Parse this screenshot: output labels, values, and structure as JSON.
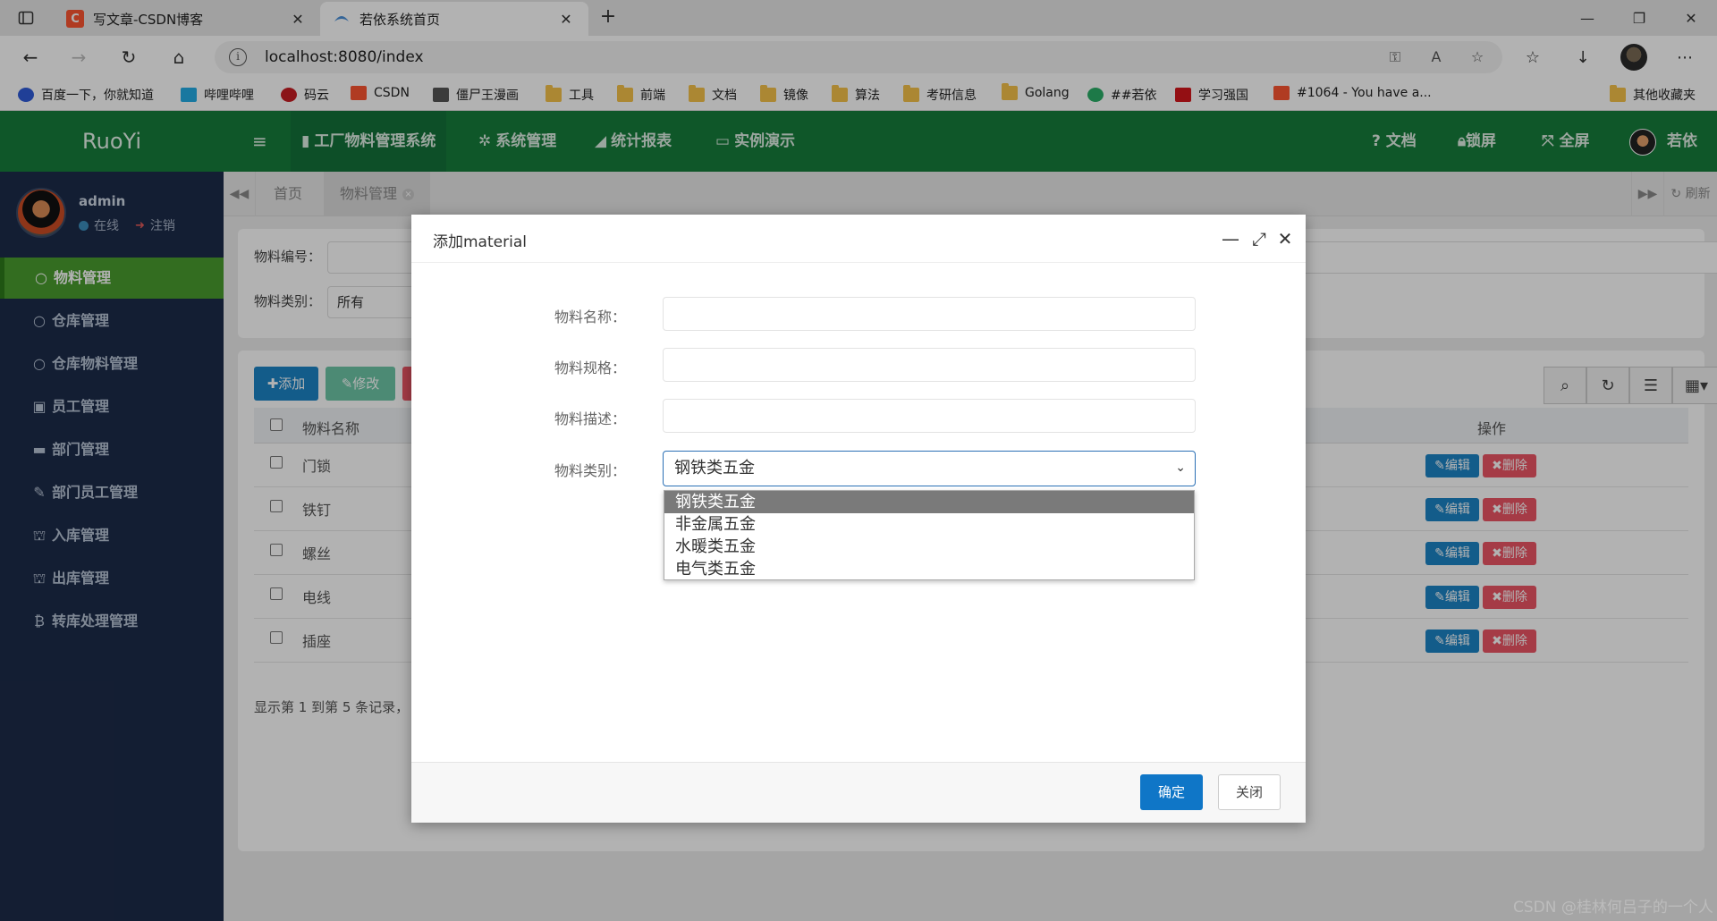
{
  "browser": {
    "tabs": [
      {
        "title": "写文章-CSDN博客",
        "favicon_letter": "C",
        "favicon_color": "#fc5531",
        "close": "✕"
      },
      {
        "title": "若依系统首页",
        "close": "✕"
      }
    ],
    "new_tab": "+",
    "window_controls": {
      "minimize": "—",
      "restore": "❐",
      "close": "✕"
    },
    "url": "localhost:8080/index",
    "bookmarks": [
      {
        "label": "百度一下，你就知道",
        "icon": "baidu-icon"
      },
      {
        "label": "哔哩哔哩",
        "icon": "bilibili-icon"
      },
      {
        "label": "码云",
        "icon": "gitee-icon"
      },
      {
        "label": "CSDN",
        "icon": "csdn-icon"
      },
      {
        "label": "僵尸王漫画",
        "icon": "manga-icon"
      },
      {
        "label": "工具",
        "icon": "folder-icon"
      },
      {
        "label": "前端",
        "icon": "folder-icon"
      },
      {
        "label": "文档",
        "icon": "folder-icon"
      },
      {
        "label": "镜像",
        "icon": "folder-icon"
      },
      {
        "label": "算法",
        "icon": "folder-icon"
      },
      {
        "label": "考研信息",
        "icon": "folder-icon"
      },
      {
        "label": "Golang",
        "icon": "folder-icon"
      },
      {
        "label": "##若依",
        "icon": "wechat-icon"
      },
      {
        "label": "学习强国",
        "icon": "xuexi-icon"
      },
      {
        "label": "#1064 - You have a...",
        "icon": "csdn-icon"
      },
      {
        "label": "其他收藏夹",
        "icon": "folder-icon"
      }
    ]
  },
  "app": {
    "brand": "RuoYi",
    "top_menu": [
      {
        "label": "工厂物料管理系统",
        "icon": "bookmark-icon"
      },
      {
        "label": "系统管理",
        "icon": "gear-icon"
      },
      {
        "label": "统计报表",
        "icon": "chart-icon"
      },
      {
        "label": "实例演示",
        "icon": "desktop-icon"
      }
    ],
    "top_right": [
      {
        "label": "文档",
        "icon": "question-icon"
      },
      {
        "label": "锁屏",
        "icon": "lock-icon"
      },
      {
        "label": "全屏",
        "icon": "fullscreen-icon"
      }
    ],
    "user_top": "若依",
    "sidebar": {
      "user_name": "admin",
      "status": "在线",
      "logout": "注销",
      "items": [
        {
          "label": "物料管理",
          "active": true
        },
        {
          "label": "仓库管理"
        },
        {
          "label": "仓库物料管理"
        },
        {
          "label": "员工管理"
        },
        {
          "label": "部门管理"
        },
        {
          "label": "部门员工管理"
        },
        {
          "label": "入库管理"
        },
        {
          "label": "出库管理"
        },
        {
          "label": "转库处理管理"
        }
      ]
    },
    "page_tabs": [
      {
        "label": "首页"
      },
      {
        "label": "物料管理",
        "active": true
      }
    ],
    "refresh": "刷新",
    "search": {
      "code_label": "物料编号：",
      "category_label": "物料类别：",
      "category_value": "所有"
    },
    "toolbar": {
      "add": "添加",
      "edit": "修改"
    },
    "table": {
      "headers": {
        "name": "物料名称",
        "actions": "操作"
      },
      "rows": [
        {
          "name": "门锁"
        },
        {
          "name": "铁钉"
        },
        {
          "name": "螺丝"
        },
        {
          "name": "电线"
        },
        {
          "name": "插座"
        }
      ],
      "edit_label": "编辑",
      "delete_label": "删除"
    },
    "pager_text": "显示第 1 到第 5 条记录，"
  },
  "dialog": {
    "title": "添加material",
    "fields": [
      {
        "label": "物料名称：",
        "value": ""
      },
      {
        "label": "物料规格：",
        "value": ""
      },
      {
        "label": "物料描述：",
        "value": ""
      }
    ],
    "category_label": "物料类别：",
    "category_selected": "钢铁类五金",
    "options": [
      "钢铁类五金",
      "非金属五金",
      "水暖类五金",
      "电气类五金"
    ],
    "ok": "确定",
    "close": "关闭"
  },
  "watermark": "CSDN @桂林何吕子的一个人"
}
